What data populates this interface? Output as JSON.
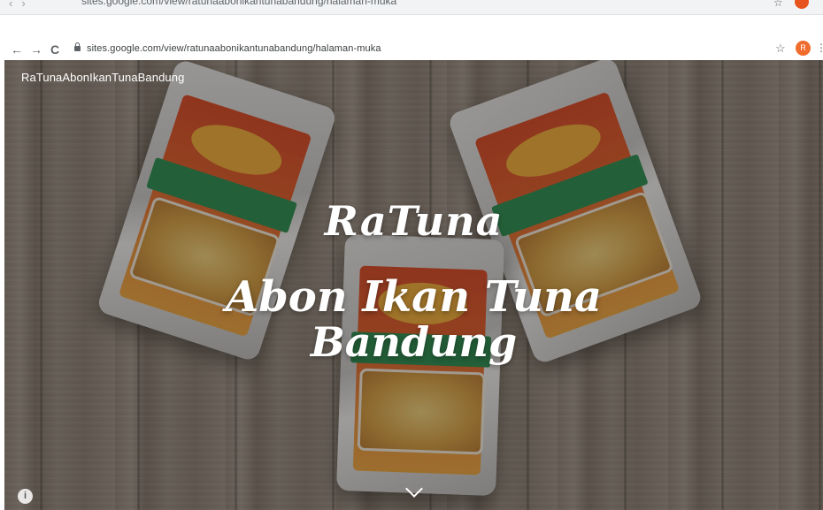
{
  "browser": {
    "ghost_url": "sites.google.com/view/ratunaabonikantunabandung/halaman-muka",
    "url": "sites.google.com/view/ratunaabonikantunabandung/halaman-muka",
    "back_icon": "←",
    "forward_icon": "→",
    "reload_icon": "C",
    "star_icon": "☆",
    "avatar_initial": "R",
    "menu_icon": "⋮",
    "colors": {
      "avatar": "#ef6c2c",
      "toolbar_text": "#5f6368"
    }
  },
  "hero": {
    "site_name": "RaTunaAbonIkanTunaBandung",
    "title_line1": "RaTuna",
    "title_line2": "Abon Ikan Tuna",
    "title_line3": "Bandung",
    "info_icon": "i",
    "scroll_icon": "chevron-down-icon"
  }
}
